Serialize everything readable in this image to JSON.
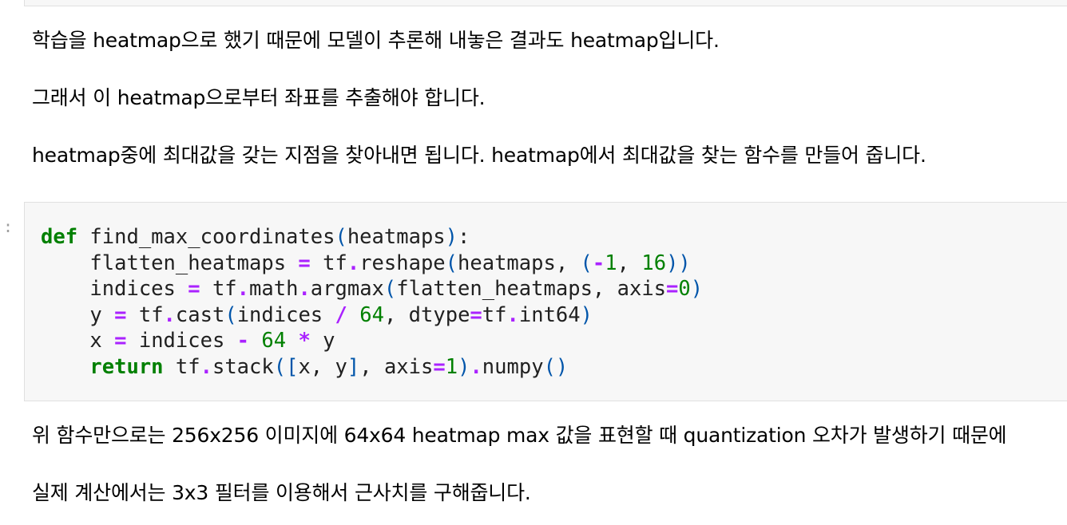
{
  "markdown": {
    "line1": "학습을 heatmap으로 했기 때문에 모델이 추론해 내놓은 결과도 heatmap입니다.",
    "line2": "그래서 이 heatmap으로부터 좌표를 추출해야 합니다.",
    "line3": "heatmap중에 최대값을 갖는 지점을 찾아내면 됩니다. heatmap에서 최대값을 찾는 함수를 만들어 줍니다.",
    "line4": "위 함수만으로는 256x256 이미지에 64x64 heatmap max 값을 표현할 때 quantization 오차가 발생하기 때문에",
    "line5": "실제 계산에서는 3x3 필터를 이용해서 근사치를 구해줍니다."
  },
  "cell": {
    "prompt_marker": ":"
  },
  "code": {
    "l1": {
      "kw": "def",
      "s1": " find_max_coordinates",
      "p1": "(",
      "s2": "heatmaps",
      "p2": ")",
      "s3": ":"
    },
    "l2": {
      "s1": "    flatten_heatmaps ",
      "o1": "=",
      "s2": " tf",
      "o2": ".",
      "s3": "reshape",
      "p1": "(",
      "s4": "heatmaps, ",
      "p2": "(",
      "o3": "-",
      "n1": "1",
      "s5": ", ",
      "n2": "16",
      "p3": "))"
    },
    "l3": {
      "s1": "    indices ",
      "o1": "=",
      "s2": " tf",
      "o2": ".",
      "s3": "math",
      "o3": ".",
      "s4": "argmax",
      "p1": "(",
      "s5": "flatten_heatmaps, axis",
      "o4": "=",
      "n1": "0",
      "p2": ")"
    },
    "l4": {
      "s1": "    y ",
      "o1": "=",
      "s2": " tf",
      "o2": ".",
      "s3": "cast",
      "p1": "(",
      "s4": "indices ",
      "o3": "/",
      "s5": " ",
      "n1": "64",
      "s6": ", dtype",
      "o4": "=",
      "s7": "tf",
      "o5": ".",
      "s8": "int64",
      "p2": ")"
    },
    "l5": {
      "s1": "    x ",
      "o1": "=",
      "s2": " indices ",
      "o2": "-",
      "s3": " ",
      "n1": "64",
      "s4": " ",
      "o3": "*",
      "s5": " y"
    },
    "l6": {
      "s1": "    ",
      "kw": "return",
      "s2": " tf",
      "o1": ".",
      "s3": "stack",
      "p1": "([",
      "s4": "x, y",
      "p2": "]",
      "s5": ", axis",
      "o2": "=",
      "n1": "1",
      "p3": ")",
      "o3": ".",
      "s6": "numpy",
      "p4": "()"
    }
  }
}
